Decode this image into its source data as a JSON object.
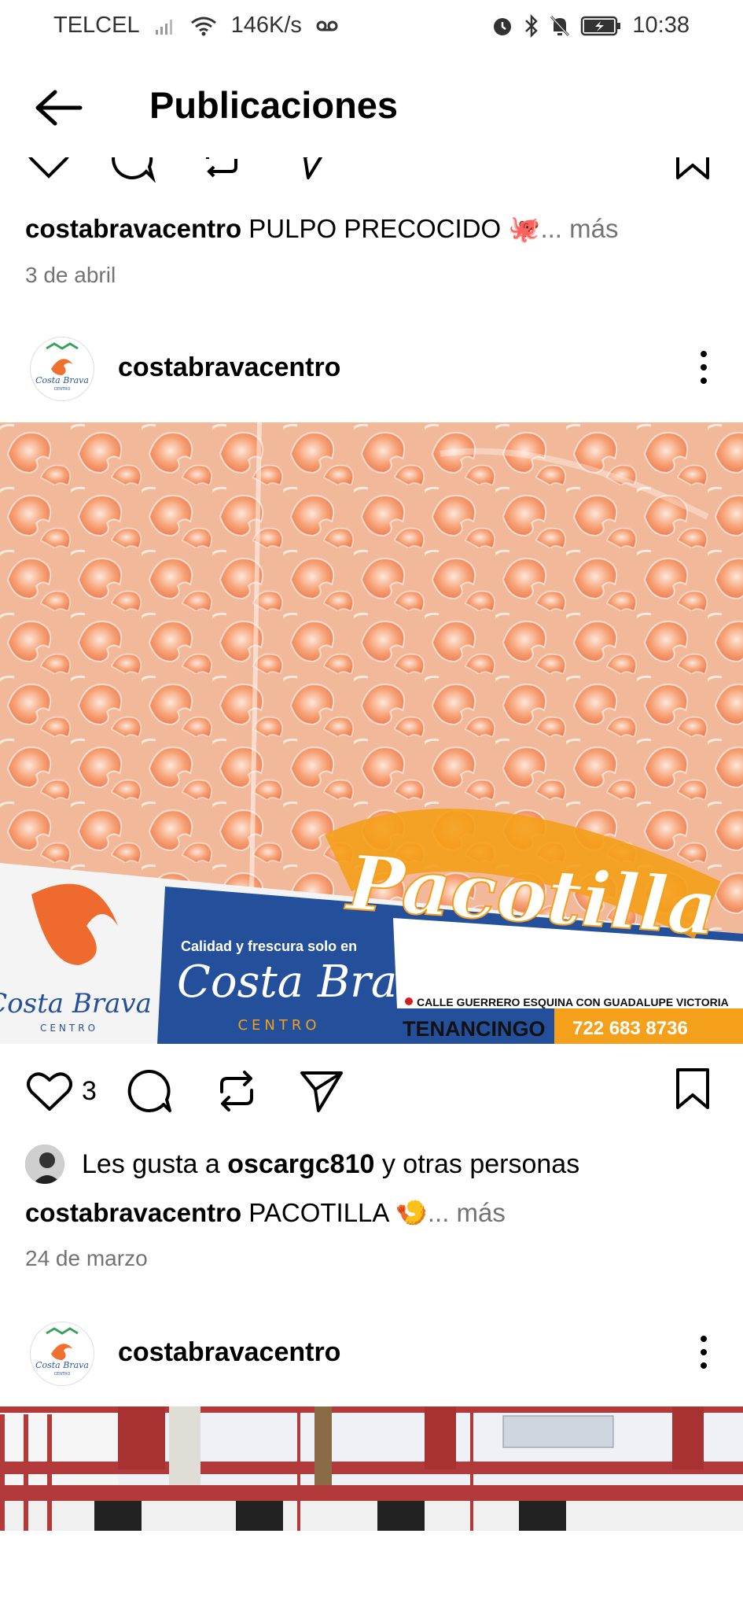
{
  "status_bar": {
    "carrier": "TELCEL",
    "speed": "146K/s",
    "time": "10:38"
  },
  "header": {
    "title": "Publicaciones"
  },
  "post_prev": {
    "username": "costabravacentro",
    "caption": "PULPO PRECOCIDO",
    "emoji": "🐙",
    "more": "... más",
    "date": "3 de abril"
  },
  "post_1": {
    "username": "costabravacentro",
    "banner": {
      "headline": "Pacotilla",
      "tagline": "Calidad y frescura solo en",
      "brand": "Costa Brava",
      "brand_sub": "CENTRO",
      "address": "CALLE GUERRERO ESQUINA CON GUADALUPE VICTORIA",
      "city": "TENANCINGO",
      "phone": "722 683 8736"
    },
    "like_count": "3",
    "likes_prefix": "Les gusta a",
    "likes_user": "oscargc810",
    "likes_suffix": "y otras personas",
    "caption": "PACOTILLA",
    "emoji": "🍤",
    "more": "... más",
    "date": "24 de marzo"
  },
  "post_2": {
    "username": "costabravacentro"
  },
  "avatar_logo": {
    "brand": "Costa Brava",
    "sub": "CENTRO"
  },
  "icons": {
    "back": "arrow-left-icon",
    "like": "heart-icon",
    "comment": "comment-icon",
    "repost": "repost-icon",
    "share": "send-icon",
    "save": "bookmark-icon",
    "more": "more-vertical-icon"
  }
}
